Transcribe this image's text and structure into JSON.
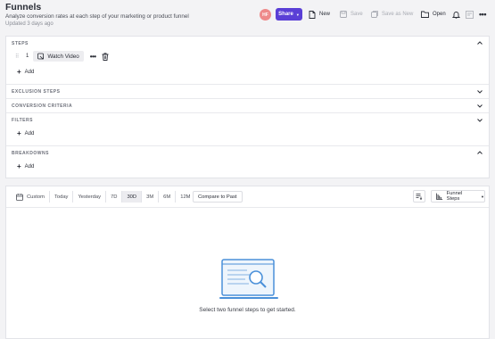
{
  "header": {
    "title": "Funnels",
    "subtitle": "Analyze conversion rates at each step of your marketing or product funnel",
    "updated": "Updated 3 days ago",
    "avatar_initials": "HF",
    "share_label": "Share",
    "new_label": "New",
    "save_label": "Save",
    "save_as_new_label": "Save as New",
    "open_label": "Open"
  },
  "sections": {
    "steps_title": "STEPS",
    "exclusion_title": "EXCLUSION STEPS",
    "conversion_title": "CONVERSION CRITERIA",
    "filters_title": "FILTERS",
    "breakdowns_title": "BREAKDOWNS",
    "add_label": "Add"
  },
  "steps": [
    {
      "number": "1",
      "event": "Watch Video"
    }
  ],
  "report": {
    "ranges": [
      "Custom",
      "Today",
      "Yesterday",
      "7D",
      "30D",
      "3M",
      "6M",
      "12M"
    ],
    "active_range": "30D",
    "compare_label": "Compare to Past",
    "chart_type_label": "Funnel Steps",
    "empty_message": "Select two funnel steps to get started."
  },
  "colors": {
    "accent": "#5a3fd6",
    "illustration": "#4a90d9"
  }
}
